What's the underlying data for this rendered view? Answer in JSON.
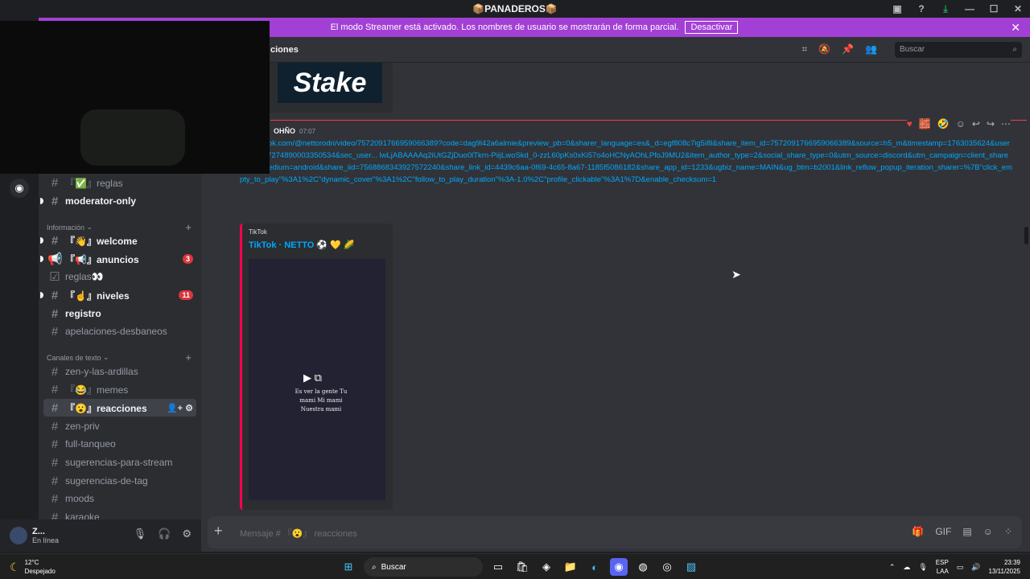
{
  "titlebar": {
    "title": "📦PANADEROS📦"
  },
  "banner": {
    "text": "El modo Streamer está activado. Los nombres de usuario se mostrarán de forma parcial.",
    "button": "Desactivar"
  },
  "sidebar": {
    "channels_top": [
      {
        "label": "『✅』reglas",
        "bold": false
      },
      {
        "label": "moderator-only",
        "bold": true
      }
    ],
    "category_info": "Información",
    "channels_info": [
      {
        "label": "『👋』welcome",
        "bold": true,
        "badge": ""
      },
      {
        "label": "『📢』anuncios",
        "bold": true,
        "badge": "3"
      },
      {
        "label": "reglas👀",
        "bold": false,
        "badge": ""
      },
      {
        "label": "『☝』niveles",
        "bold": true,
        "badge": "11"
      },
      {
        "label": "registro",
        "bold": true,
        "badge": ""
      },
      {
        "label": "apelaciones-desbaneos",
        "bold": false,
        "badge": ""
      }
    ],
    "category_text": "Canales de texto",
    "channels_text": [
      "zen-y-las-ardillas",
      "『😂』memes",
      "『😮』reacciones",
      "zen-priv",
      "full-tanqueo",
      "sugerencias-para-stream",
      "sugerencias-de-tag",
      "moods",
      "karaoke"
    ]
  },
  "user": {
    "name": "Z...",
    "status": "En línea"
  },
  "header": {
    "channel": "ciones",
    "search_placeholder": "Buscar"
  },
  "message": {
    "author": "OHÑO",
    "time": "07:07",
    "link": "www.tiktok.com/@nettorodri/video/7572091766959066389?code=dag9l42a6almie&preview_pb=0&sharer_language=es&_d=egf808c7ig5i8l&share_item_id=7572091766959066389&source=h5_m&timestamp=1763035624&user_id=6787274890003350534&sec_user... lwLjABAAAAq2iUtGZjDuo0lTkrn-PiijLwoSkd_0-zzL60pKs0xKi57o4oHCNyAOhLPfoJ9MU2&item_author_type=2&social_share_type=0&utm_source=discord&utm_campaign=client_share&utm_medium=android&share_iid=7568868343927572240&share_link_id=4439c6aa-0f69-4c65-8a67-1185f5086182&share_app_id=1233&ugbiz_name=MAIN&ug_btm=b2001&link_reflow_popup_iteration_sharer=%7B\"click_empty_to_play\"%3A1%2C\"dynamic_cover\"%3A1%2C\"follow_to_play_duration\"%3A-1.0%2C\"profile_clickable\"%3A1%7D&enable_checksum=1",
    "embed_provider": "TikTok",
    "embed_title": "TikTok · NETTO ⚽ 💛 🌽",
    "video_caption": "Es ver la gente Tu mami Mi mami Nuestra mami"
  },
  "composer": {
    "placeholder": "Mensaje # 『😮』 reacciones"
  },
  "taskbar": {
    "temp": "12°C",
    "weather": "Despejado",
    "search": "Buscar",
    "lang": "ESP",
    "lang2": "LAA",
    "time": "23:39",
    "date": "13/11/2025"
  }
}
